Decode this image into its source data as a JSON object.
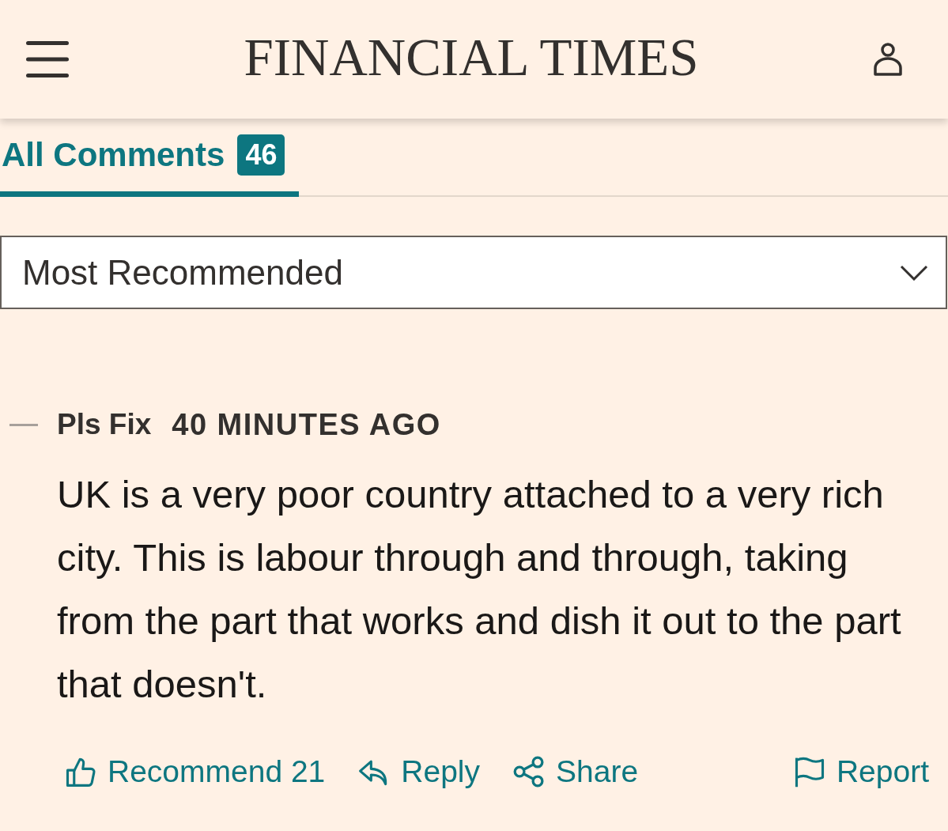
{
  "header": {
    "logo": "FINANCIAL TIMES"
  },
  "tabs": [
    {
      "label": "All Comments",
      "count": "46",
      "selected": true
    }
  ],
  "sort": {
    "value": "Most Recommended"
  },
  "comments": [
    {
      "author": "Pls Fix",
      "time": "40 MINUTES AGO",
      "body": "UK is a very poor country attached to a very rich city. This is labour through and through, taking from the part that works and dish it out to the part that doesn't.",
      "actions": [
        {
          "kind": "recommend",
          "label": "Recommend 21"
        },
        {
          "kind": "reply",
          "label": "Reply"
        },
        {
          "kind": "share",
          "label": "Share"
        },
        {
          "kind": "report",
          "label": "Report"
        }
      ]
    }
  ]
}
